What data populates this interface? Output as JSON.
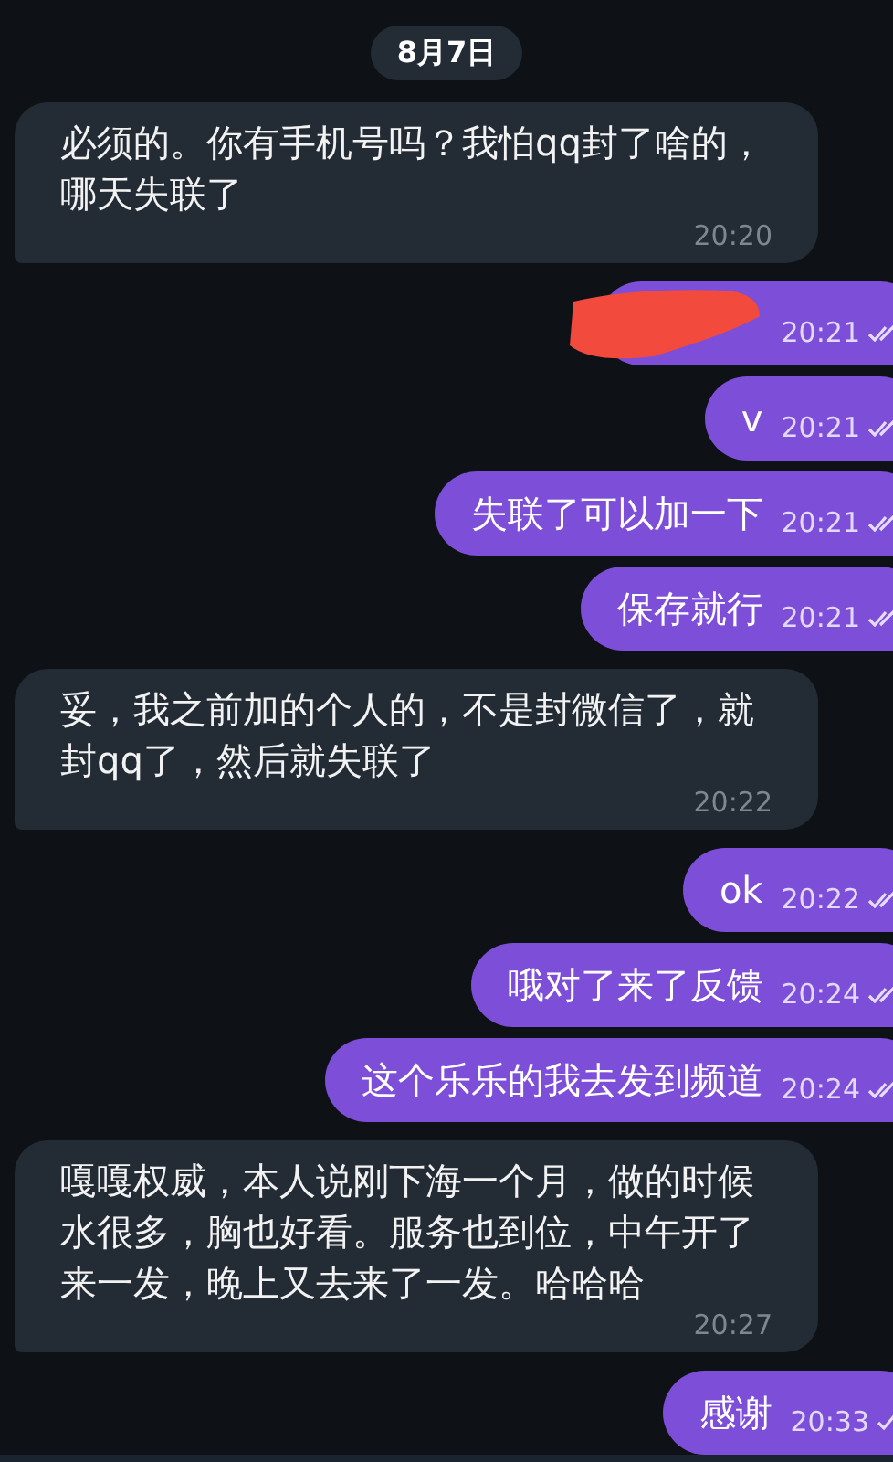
{
  "date_chip": "8月7日",
  "messages": [
    {
      "kind": "incoming",
      "text": "必须的。你有手机号吗？我怕qq封了啥的，哪天失联了",
      "time": "20:20"
    },
    {
      "kind": "redacted",
      "time": "20:21",
      "read": true
    },
    {
      "kind": "outgoing",
      "text": "v",
      "time": "20:21",
      "read": true
    },
    {
      "kind": "outgoing",
      "text": "失联了可以加一下",
      "time": "20:21",
      "read": true
    },
    {
      "kind": "outgoing",
      "text": "保存就行",
      "time": "20:21",
      "read": true
    },
    {
      "kind": "incoming",
      "text": "妥，我之前加的个人的，不是封微信了，就封qq了，然后就失联了",
      "time": "20:22"
    },
    {
      "kind": "outgoing",
      "text": "ok",
      "time": "20:22",
      "read": true
    },
    {
      "kind": "outgoing",
      "text": "哦对了来了反馈",
      "time": "20:24",
      "read": true
    },
    {
      "kind": "outgoing",
      "text": "这个乐乐的我去发到频道",
      "time": "20:24",
      "read": true
    },
    {
      "kind": "incoming",
      "text": "嘎嘎权威，本人说刚下海一个月，做的时候水很多，胸也好看。服务也到位，中午开了来一发，晚上又去来了一发。哈哈哈",
      "time": "20:27"
    },
    {
      "kind": "outgoing",
      "text": "感谢",
      "time": "20:33",
      "read": false
    }
  ]
}
